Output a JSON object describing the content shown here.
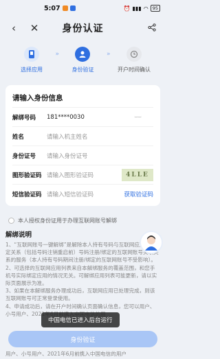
{
  "statusbar": {
    "time": "5:07",
    "battery": "95"
  },
  "nav": {
    "title": "身份认证"
  },
  "steps": [
    {
      "label": "选择应用",
      "state": "done"
    },
    {
      "label": "身份验证",
      "state": "active"
    },
    {
      "label": "开户时间确认",
      "state": "todo"
    }
  ],
  "card": {
    "title": "请输入身份信息",
    "rows": [
      {
        "key": "解绑号码",
        "value": "181****0030"
      },
      {
        "key": "姓名",
        "placeholder": "请输入机主姓名"
      },
      {
        "key": "身份证号",
        "placeholder": "请输入身份证号"
      },
      {
        "key": "图形验证码",
        "placeholder": "请输入图形验证码",
        "captcha": "4LLE"
      },
      {
        "key": "短信验证码",
        "placeholder": "请输入短信验证码",
        "action": "获取验证码"
      }
    ]
  },
  "agreement": "本人授权身份证用于办理互联网账号解绑",
  "explain": {
    "title": "解绑说明",
    "items": [
      "1、“互联网账号一键解绑”是解除本人持有号码与互联网应用的绑定关系（包括号码注销重启前）号码注册/绑定的互联网账号关联关系的服务（本人持有号码期间注册/绑定的互联网账号不受影响）。",
      "2、可选择的互联网应用列表来自本解绑服务的覆盖范围，和您手机号实际绑定应用的情况无关。可解绑应用列表可能更新，请以实际页面展示为准。",
      "3、如果在本解绑服务办理成功后，互联网应用已处理完成，则该互联网账号可正常登录使用。",
      "4、申请成功后，请在开户时间确认页面确认信息，您可以用户、小号用户、2021年6月前携入中国电信的用"
    ],
    "last_line": "用户、小号用户、2021年6月前携入中国电信的用户"
  },
  "toast": "中国电信已进入后台运行",
  "submit_label": "身份验证",
  "colors": {
    "accent": "#2f6fe0",
    "button_disabled": "#a9c6f6"
  }
}
